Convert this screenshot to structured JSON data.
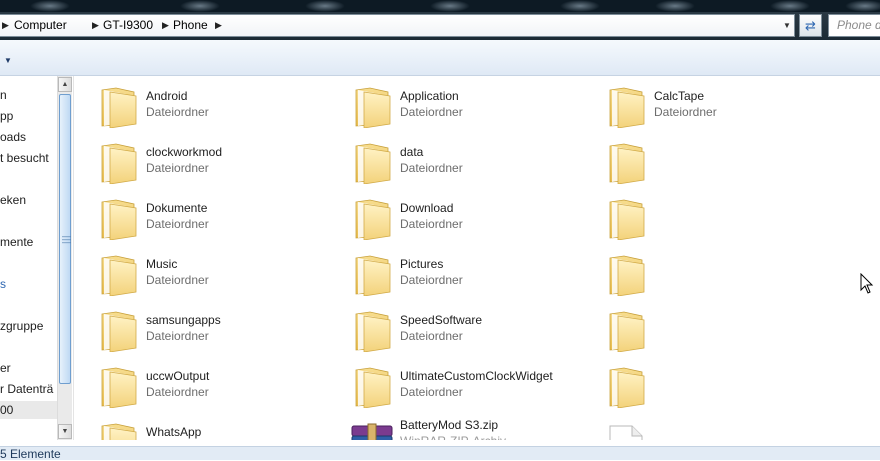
{
  "breadcrumb": {
    "items": [
      "Computer",
      "GT-I9300",
      "Phone"
    ]
  },
  "search": {
    "placeholder": "Phone d"
  },
  "navigation": {
    "items": [
      "n",
      "pp",
      "oads",
      "t besucht",
      "eken",
      "mente",
      "s",
      "zgruppe",
      "er",
      "r Datenträ",
      "00"
    ]
  },
  "content": {
    "folders": [
      {
        "name": "Android",
        "type": "Dateiordner"
      },
      {
        "name": "Application",
        "type": "Dateiordner"
      },
      {
        "name": "CalcTape",
        "type": "Dateiordner"
      },
      {
        "name": "clockworkmod",
        "type": "Dateiordner"
      },
      {
        "name": "data",
        "type": "Dateiordner"
      },
      {
        "name": "Dokumente",
        "type": "Dateiordner"
      },
      {
        "name": "Download",
        "type": "Dateiordner"
      },
      {
        "name": "Music",
        "type": "Dateiordner"
      },
      {
        "name": "Pictures",
        "type": "Dateiordner"
      },
      {
        "name": "samsungapps",
        "type": "Dateiordner"
      },
      {
        "name": "SpeedSoftware",
        "type": "Dateiordner"
      },
      {
        "name": "uccwOutput",
        "type": "Dateiordner"
      },
      {
        "name": "UltimateCustomClockWidget",
        "type": "Dateiordner"
      },
      {
        "name": "WhatsApp",
        "type": ""
      }
    ],
    "files": [
      {
        "name": "BatteryMod S3.zip",
        "type": "WinRAR-ZIP-Archiv"
      }
    ]
  },
  "status": {
    "text": "5 Elemente"
  },
  "colors": {
    "folder": "#f3d27a",
    "accent": "#2e67b1",
    "statusbar": "#e2ebf5"
  },
  "icons": [
    "folder-icon",
    "winrar-archive-icon",
    "document-icon",
    "refresh-icon",
    "dropdown-arrow-icon"
  ]
}
